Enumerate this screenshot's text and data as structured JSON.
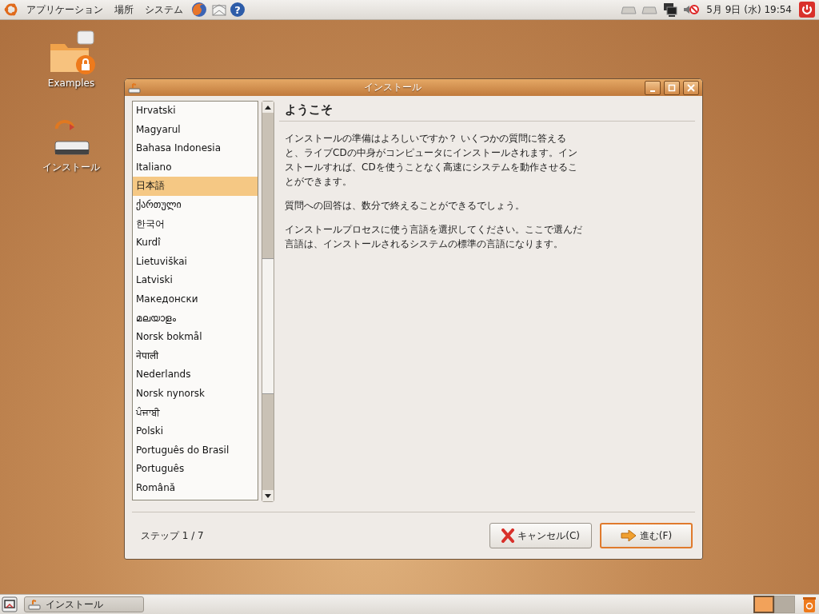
{
  "top_panel": {
    "menus": [
      "アプリケーション",
      "場所",
      "システム"
    ],
    "help_icon": "?",
    "clock": "5月 9日 (水) 19:54"
  },
  "desktop_icons": [
    {
      "label": "Examples",
      "kind": "folder"
    },
    {
      "label": "インストール",
      "kind": "installer"
    }
  ],
  "window": {
    "title": "インストール",
    "languages": [
      {
        "label": "Hrvatski",
        "selected": false
      },
      {
        "label": "Magyarul",
        "selected": false
      },
      {
        "label": "Bahasa Indonesia",
        "selected": false
      },
      {
        "label": "Italiano",
        "selected": false
      },
      {
        "label": "日本語",
        "selected": true
      },
      {
        "label": "ქართული",
        "selected": false
      },
      {
        "label": "한국어",
        "selected": false
      },
      {
        "label": "Kurdî",
        "selected": false
      },
      {
        "label": "Lietuviškai",
        "selected": false
      },
      {
        "label": "Latviski",
        "selected": false
      },
      {
        "label": "Македонски",
        "selected": false
      },
      {
        "label": "മലയാളം",
        "selected": false
      },
      {
        "label": "Norsk bokmål",
        "selected": false
      },
      {
        "label": "नेपाली",
        "selected": false
      },
      {
        "label": "Nederlands",
        "selected": false
      },
      {
        "label": "Norsk nynorsk",
        "selected": false
      },
      {
        "label": "ਪੰਜਾਬੀ",
        "selected": false
      },
      {
        "label": "Polski",
        "selected": false
      },
      {
        "label": "Português do Brasil",
        "selected": false
      },
      {
        "label": "Português",
        "selected": false
      },
      {
        "label": "Română",
        "selected": false
      }
    ],
    "heading": "ようこそ",
    "paragraphs": [
      "インストールの準備はよろしいですか？ いくつかの質問に答えると、ライブCDの中身がコンピュータにインストールされます。インストールすれば、CDを使うことなく高速にシステムを動作させることができます。",
      "質問への回答は、数分で終えることができるでしょう。",
      "インストールプロセスに使う言語を選択してください。ここで選んだ言語は、インストールされるシステムの標準の言語になります。"
    ],
    "step": "ステップ 1 / 7",
    "buttons": [
      {
        "label": "キャンセル(C)",
        "kind": "cancel"
      },
      {
        "label": "進む(F)",
        "kind": "forward"
      }
    ]
  },
  "taskbar": {
    "tasks": [
      {
        "label": "インストール"
      }
    ],
    "workspaces": [
      {
        "selected": true
      },
      {
        "selected": false
      }
    ]
  }
}
